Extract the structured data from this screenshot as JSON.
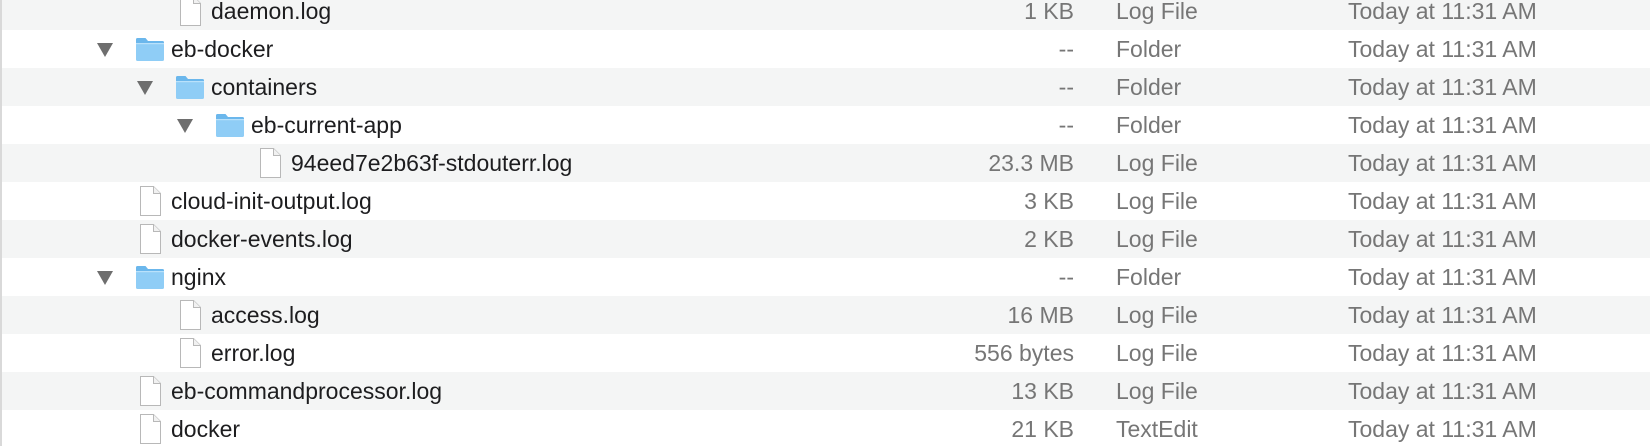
{
  "rows": [
    {
      "name": "daemon.log",
      "size": "1 KB",
      "kind": "Log File",
      "date": "Today at 11:31 AM",
      "type": "file",
      "depth": 2,
      "expanded": false
    },
    {
      "name": "eb-docker",
      "size": "--",
      "kind": "Folder",
      "date": "Today at 11:31 AM",
      "type": "folder",
      "depth": 1,
      "expanded": true
    },
    {
      "name": "containers",
      "size": "--",
      "kind": "Folder",
      "date": "Today at 11:31 AM",
      "type": "folder",
      "depth": 2,
      "expanded": true
    },
    {
      "name": "eb-current-app",
      "size": "--",
      "kind": "Folder",
      "date": "Today at 11:31 AM",
      "type": "folder",
      "depth": 3,
      "expanded": true
    },
    {
      "name": "94eed7e2b63f-stdouterr.log",
      "size": "23.3 MB",
      "kind": "Log File",
      "date": "Today at 11:31 AM",
      "type": "file",
      "depth": 4,
      "expanded": false
    },
    {
      "name": "cloud-init-output.log",
      "size": "3 KB",
      "kind": "Log File",
      "date": "Today at 11:31 AM",
      "type": "file",
      "depth": 1,
      "expanded": false
    },
    {
      "name": "docker-events.log",
      "size": "2 KB",
      "kind": "Log File",
      "date": "Today at 11:31 AM",
      "type": "file",
      "depth": 1,
      "expanded": false
    },
    {
      "name": "nginx",
      "size": "--",
      "kind": "Folder",
      "date": "Today at 11:31 AM",
      "type": "folder",
      "depth": 1,
      "expanded": true
    },
    {
      "name": "access.log",
      "size": "16 MB",
      "kind": "Log File",
      "date": "Today at 11:31 AM",
      "type": "file",
      "depth": 2,
      "expanded": false
    },
    {
      "name": "error.log",
      "size": "556 bytes",
      "kind": "Log File",
      "date": "Today at 11:31 AM",
      "type": "file",
      "depth": 2,
      "expanded": false
    },
    {
      "name": "eb-commandprocessor.log",
      "size": "13 KB",
      "kind": "Log File",
      "date": "Today at 11:31 AM",
      "type": "file",
      "depth": 1,
      "expanded": false
    },
    {
      "name": "docker",
      "size": "21 KB",
      "kind": "TextEdit",
      "date": "Today at 11:31 AM",
      "type": "file",
      "depth": 1,
      "expanded": false
    }
  ]
}
